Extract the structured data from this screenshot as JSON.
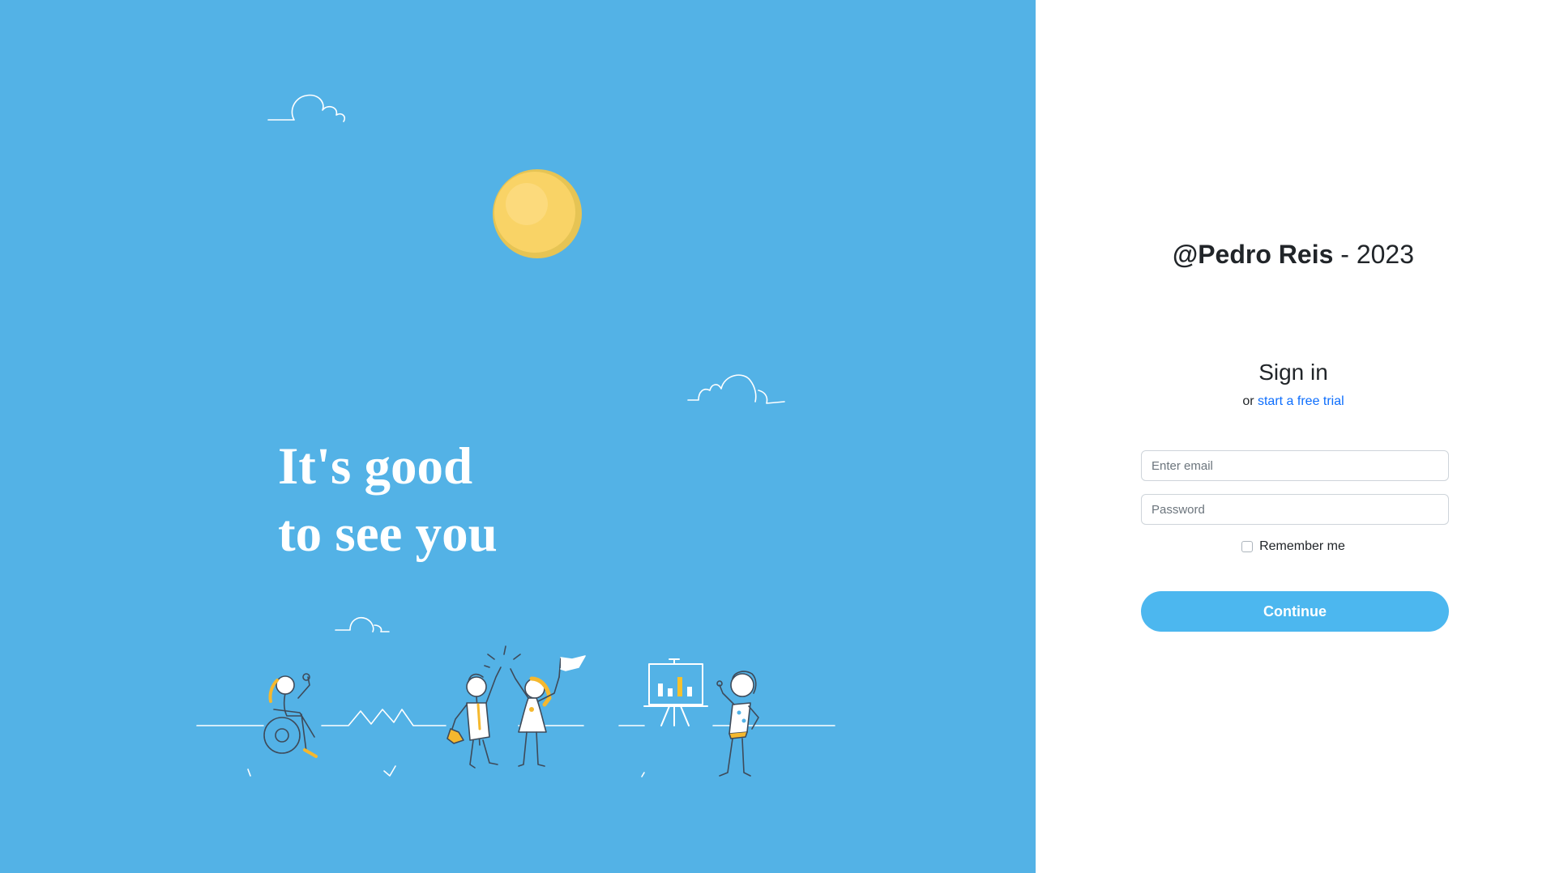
{
  "hero": {
    "headline_line1": "It's good",
    "headline_line2": "to see you",
    "illustration": "people-celebrating-illustration",
    "sun_icon": "sun-icon",
    "cloud_icon": "cloud-icon",
    "presentation_board_icon": "bar-chart-board-icon",
    "background_color": "#53b2e6",
    "accent_color": "#f5c12e"
  },
  "brand": {
    "name": "@Pedro Reis",
    "separator": " - ",
    "year": "2023"
  },
  "signin": {
    "title": "Sign in",
    "prefix": "or ",
    "trial_link": "start a free trial",
    "email_placeholder": "Enter email",
    "email_value": "",
    "password_placeholder": "Password",
    "password_value": "",
    "remember_label": "Remember me",
    "remember_checked": false,
    "continue_label": "Continue",
    "button_color": "#4cb7ef",
    "link_color": "#0d6efd"
  }
}
